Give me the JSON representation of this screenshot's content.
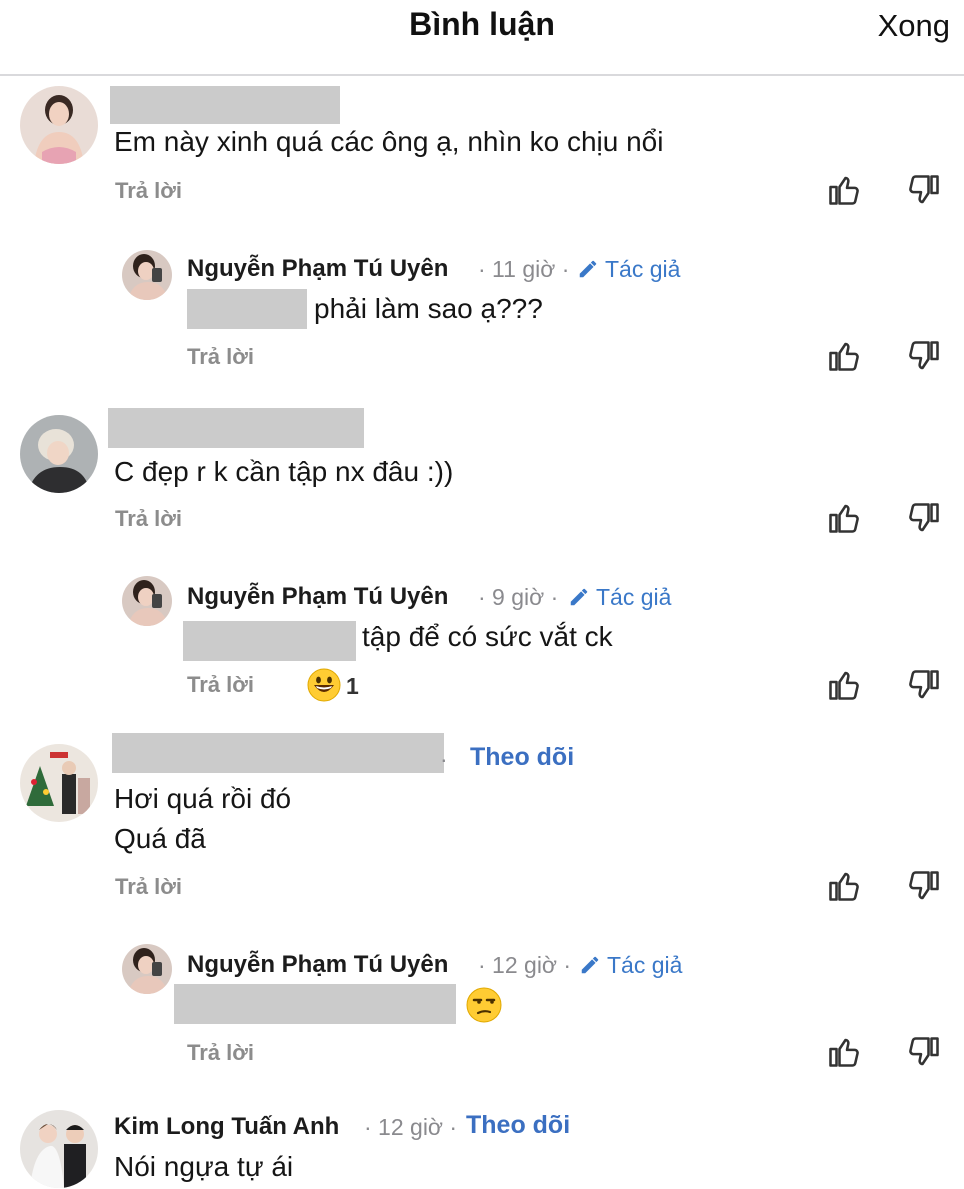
{
  "header": {
    "title": "Bình luận",
    "done_label": "Xong"
  },
  "reply_label": "Trả lời",
  "author_badge_label": "Tác giả",
  "follow_label": "Theo dõi",
  "comments": [
    {
      "text": "Em này xinh quá các ông ạ, nhìn ko chịu nổi"
    },
    {
      "name": "Nguyễn Phạm Tú Uyên",
      "meta": "· 11 giờ ·",
      "text": "phải làm sao ạ???"
    },
    {
      "text": "C đẹp r k cần tập nx đâu :))"
    },
    {
      "name": "Nguyễn Phạm Tú Uyên",
      "meta": "· 9 giờ ·",
      "text": "tập để có sức vắt ck",
      "reaction_count": "1"
    },
    {
      "meta": "· ",
      "line1": "Hơi quá rồi đó",
      "line2": "Quá đã"
    },
    {
      "name": "Nguyễn Phạm Tú Uyên",
      "meta": "· 12 giờ ·"
    },
    {
      "name": "Kim Long Tuấn Anh",
      "meta": "· 12 giờ ·",
      "text": "Nói ngựa tự ái"
    }
  ],
  "icons": [
    "thumbs-up-icon",
    "thumbs-down-icon",
    "pencil-icon",
    "grinning-emoji",
    "unamused-emoji"
  ],
  "colors": {
    "link": "#3b6fc1",
    "meta": "#8a8a8e",
    "redaction": "#cbcbcb"
  }
}
